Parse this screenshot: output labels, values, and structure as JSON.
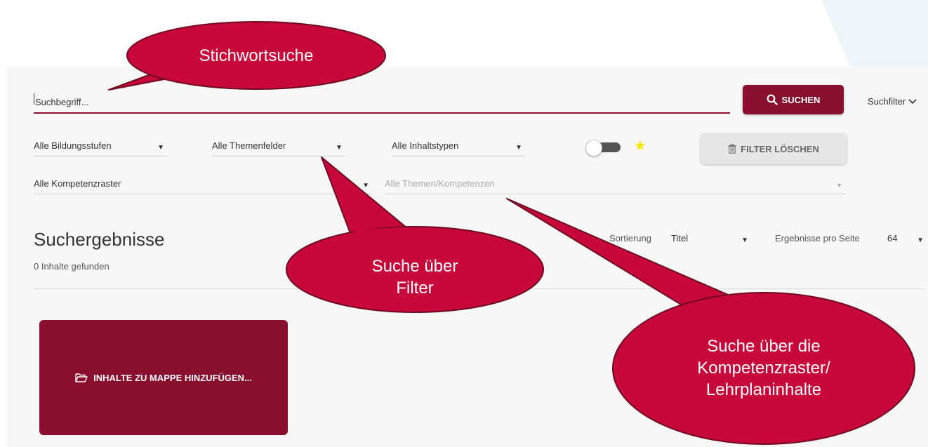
{
  "search": {
    "placeholder": "Suchbegriff...",
    "button_label": "SUCHEN",
    "filter_toggle_label": "Suchfilter"
  },
  "filters": {
    "bildungsstufen": "Alle Bildungsstufen",
    "themenfelder": "Alle Themenfelder",
    "inhaltstypen": "Alle Inhaltstypen",
    "kompetenzraster": "Alle Kompetenzraster",
    "themen_kompetenzen": "Alle Themen/Kompetenzen",
    "clear_button_label": "FILTER LÖSCHEN",
    "favorites_toggle_on": false
  },
  "results": {
    "title": "Suchergebnisse",
    "count_text": "0 Inhalte gefunden",
    "sort_label": "Sortierung",
    "sort_value": "Titel",
    "per_page_label": "Ergebnisse pro Seite",
    "per_page_value": "64"
  },
  "mappe": {
    "label": "INHALTE ZU MAPPE HINZUFÜGEN..."
  },
  "callouts": {
    "stichwortsuche": "Stichwortsuche",
    "filter": "Suche über\nFilter",
    "kompetenz": "Suche über die\nKompetenzraster/\nLehrplaninhalte"
  },
  "colors": {
    "brand": "#8a0e2e",
    "callout": "#c8073a",
    "star": "#f3e600"
  },
  "icons": {
    "search": "search-icon",
    "chevron": "chevron-down-icon",
    "trash": "trash-icon",
    "star": "star-icon",
    "folder": "folder-open-icon"
  }
}
